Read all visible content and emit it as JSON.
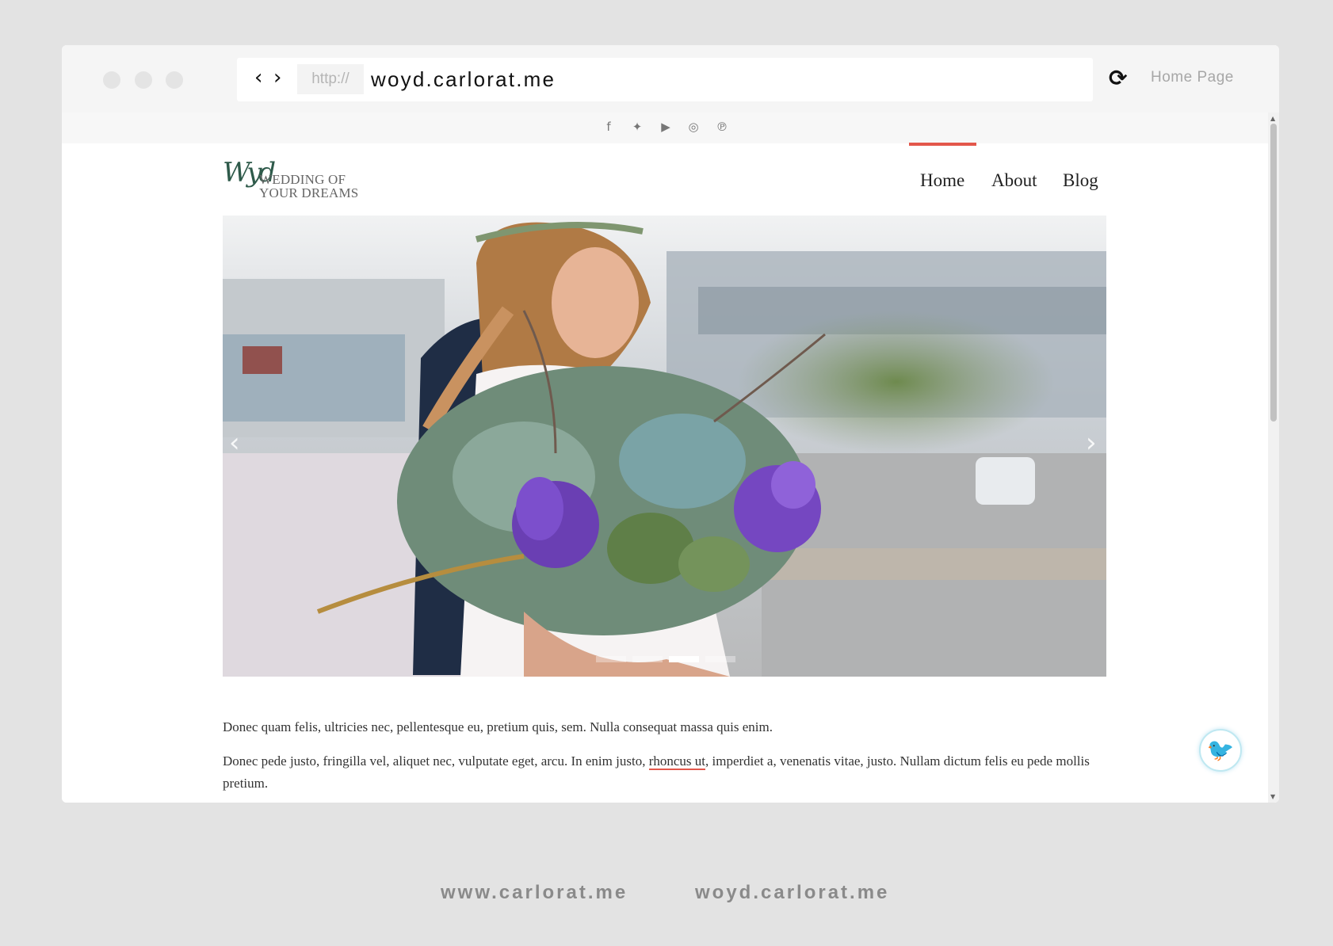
{
  "browser": {
    "back_icon": "chevron-left-icon",
    "forward_icon": "chevron-right-icon",
    "protocol": "http://",
    "url": "woyd.carlorat.me",
    "reload_icon": "reload-icon",
    "home_label": "Home Page"
  },
  "social": {
    "items": [
      {
        "name": "facebook-icon",
        "glyph": "f"
      },
      {
        "name": "twitter-icon",
        "glyph": "🐦"
      },
      {
        "name": "youtube-icon",
        "glyph": "▶"
      },
      {
        "name": "instagram-icon",
        "glyph": "◎"
      },
      {
        "name": "pinterest-icon",
        "glyph": "℗"
      }
    ]
  },
  "site": {
    "logo_mono": "Wyd",
    "logo_line1": "WEDDING OF",
    "logo_line2": "YOUR DREAMS",
    "nav": [
      "Home",
      "About",
      "Blog"
    ],
    "active_nav": "Home",
    "accent_color": "#e3574b"
  },
  "slider": {
    "prev_icon": "chevron-left-icon",
    "next_icon": "chevron-right-icon",
    "slide_count": 4,
    "active_slide": 3
  },
  "content": {
    "para1": "Donec quam felis, ultricies nec, pellentesque eu, pretium quis, sem. Nulla consequat massa quis enim.",
    "para2_before": "Donec pede justo, fringilla vel, aliquet nec, vulputate eget, arcu. In enim justo, ",
    "para2_link": "rhoncus ut",
    "para2_after": ", imperdiet a, venenatis vitae, justo. Nullam dictum felis eu pede mollis pretium."
  },
  "fab": {
    "icon": "bird-icon"
  },
  "footer": {
    "link1": "www.carlorat.me",
    "link2": "woyd.carlorat.me"
  }
}
